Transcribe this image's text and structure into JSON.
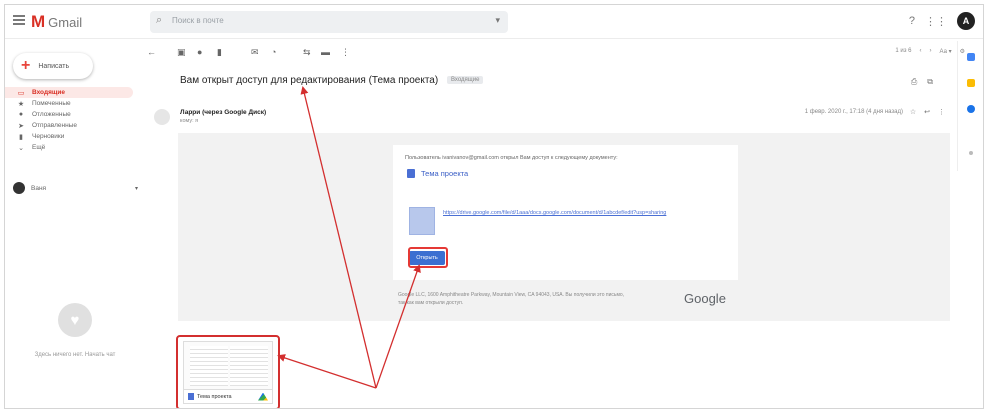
{
  "header": {
    "app_name": "Gmail",
    "search_placeholder": "Поиск в почте"
  },
  "sidebar": {
    "compose_label": "Написать",
    "items": [
      {
        "label": "Входящие",
        "icon": "inbox-icon"
      },
      {
        "label": "Помеченные",
        "icon": "star-icon"
      },
      {
        "label": "Отложенные",
        "icon": "clock-icon"
      },
      {
        "label": "Отправленные",
        "icon": "send-icon"
      },
      {
        "label": "Черновики",
        "icon": "draft-icon"
      },
      {
        "label": "Ещё",
        "icon": "chevron-down-icon"
      }
    ],
    "account_label": "Ваня",
    "hangouts_text": "Здесь ничего нет. Начать чат"
  },
  "toolbar": {
    "pager": "1 из 6"
  },
  "message": {
    "subject": "Вам открыт доступ для редактирования (Тема проекта)",
    "subject_badge": "Входящие",
    "sender": "Ларри (через Google Диск)",
    "recipient": "кому: я",
    "date": "1 февр. 2020 г., 17:18 (4 дня назад)",
    "intro": "Пользователь ivanivanov@gmail.com открыл Вам доступ к следующему документу:",
    "doc_name": "Тема проекта",
    "doc_link": "https://drive.google.com/file/d/1aaa/docs.google.com/document/d/1abcdef/edit?usp=sharing",
    "open_button": "Открыть",
    "footer": "Google LLC, 1600 Amphitheatre Parkway, Mountain View, CA 94043, USA. Вы получили это письмо, так как вам открыли доступ.",
    "google_wordmark": "Google"
  },
  "attachment": {
    "name": "Тема проекта"
  },
  "colors": {
    "brand_red": "#d93025",
    "annotation_red": "#d32f2f",
    "doc_blue": "#4a6fd4"
  }
}
